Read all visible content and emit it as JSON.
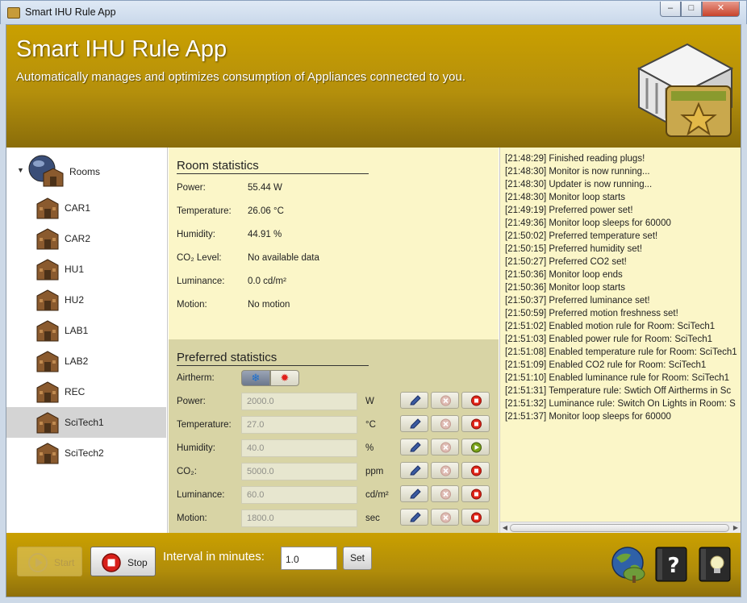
{
  "window": {
    "title": "Smart IHU Rule App",
    "min_glyph": "–",
    "max_glyph": "□",
    "close_glyph": "✕"
  },
  "header": {
    "title": "Smart IHU Rule App",
    "subtitle": "Automatically manages and optimizes consumption of Appliances connected to you."
  },
  "tree": {
    "root_label": "Rooms",
    "items": [
      "CAR1",
      "CAR2",
      "HU1",
      "HU2",
      "LAB1",
      "LAB2",
      "REC",
      "SciTech1",
      "SciTech2"
    ],
    "selected": "SciTech1"
  },
  "room_stats": {
    "title": "Room statistics",
    "rows": [
      {
        "label": "Power:",
        "value": "55.44 W"
      },
      {
        "label": "Temperature:",
        "value": "26.06 °C"
      },
      {
        "label": "Humidity:",
        "value": "44.91 %"
      },
      {
        "label": "CO₂ Level:",
        "value": "No available data"
      },
      {
        "label": "Luminance:",
        "value": "0.0 cd/m²"
      },
      {
        "label": "Motion:",
        "value": "No motion"
      }
    ]
  },
  "preferred": {
    "title": "Preferred statistics",
    "airtherm_label": "Airtherm:",
    "airtherm_cool_icon": "snowflake-icon",
    "airtherm_heat_icon": "heat-icon",
    "rows": [
      {
        "label": "Power:",
        "value": "2000.0",
        "unit": "W",
        "state": "stop"
      },
      {
        "label": "Temperature:",
        "value": "27.0",
        "unit": "°C",
        "state": "stop"
      },
      {
        "label": "Humidity:",
        "value": "40.0",
        "unit": "%",
        "state": "play"
      },
      {
        "label": "CO₂:",
        "value": "5000.0",
        "unit": "ppm",
        "state": "stop"
      },
      {
        "label": "Luminance:",
        "value": "60.0",
        "unit": "cd/m²",
        "state": "stop"
      },
      {
        "label": "Motion:",
        "value": "1800.0",
        "unit": "sec",
        "state": "stop"
      }
    ]
  },
  "log": [
    "[21:48:29] Finished reading plugs!",
    "[21:48:30] Monitor is now running...",
    "[21:48:30] Updater is now running...",
    "[21:48:30] Monitor loop starts",
    "[21:49:19] Preferred power set!",
    "[21:49:36] Monitor loop sleeps for 60000",
    "[21:50:02] Preferred temperature set!",
    "[21:50:15] Preferred humidity set!",
    "[21:50:27] Preferred CO2 set!",
    "[21:50:36] Monitor loop ends",
    "[21:50:36] Monitor loop starts",
    "[21:50:37] Preferred luminance set!",
    "[21:50:59] Preferred motion freshness set!",
    "[21:51:02] Enabled motion rule for Room: SciTech1",
    "[21:51:03] Enabled power rule for Room: SciTech1",
    "[21:51:08] Enabled temperature rule for Room: SciTech1",
    "[21:51:09] Enabled CO2 rule for Room: SciTech1",
    "[21:51:10] Enabled luminance rule for Room: SciTech1",
    "[21:51:31] Temperature rule: Swtich Off Airtherms in Sc",
    "[21:51:32] Luminance rule: Switch On Lights in Room: S",
    "[21:51:37] Monitor loop sleeps for 60000"
  ],
  "footer": {
    "start_label": "Start",
    "stop_label": "Stop",
    "interval_label": "Interval in minutes:",
    "interval_value": "1.0",
    "set_label": "Set"
  },
  "colors": {
    "header_gold": "#caa000",
    "panel_cream": "#fbf6c8",
    "prefs_tan": "#d8d4a5"
  }
}
